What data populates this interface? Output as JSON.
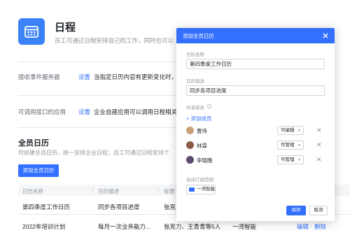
{
  "app": {
    "title": "日程",
    "description": "员工可通过日程安排自己的工作，同时也可以"
  },
  "settings": [
    {
      "label": "接收事件服务器",
      "link": "设置",
      "desc": "当指定日历内容有更新变化时，"
    },
    {
      "label": "可调用接口的应用",
      "link": "设置",
      "desc": "企业自建应用可以调用日程相关"
    }
  ],
  "section": {
    "title": "全员日历",
    "description": "可创建全员日历，统一安排企业日程；员工可通过日程安排个",
    "add_button": "添加全员日历"
  },
  "table": {
    "headers": [
      "日历名称",
      "日历描述",
      "管理"
    ],
    "rows": [
      {
        "name": "第四季度工作日历",
        "desc": "同步各项目进度",
        "managers": "张克",
        "sync": "",
        "ops": []
      },
      {
        "name": "2022年培训计划",
        "desc": "每月一次业务能力...",
        "managers": "张克力、王青青等5人",
        "sync": "一湾智能",
        "ops": [
          "编辑",
          "删除"
        ]
      }
    ]
  },
  "modal": {
    "title": "添加全员日历",
    "name_label": "日历名称",
    "name_value": "第四季度工作日历",
    "desc_label": "日历描述",
    "desc_value": "同步各项目进度",
    "members_label": "共享成员",
    "add_member": "添加成员",
    "members": [
      {
        "name": "曹伟",
        "permission": "可编辑"
      },
      {
        "name": "林霖",
        "permission": "可管理"
      },
      {
        "name": "李晓晚",
        "permission": "可管理"
      }
    ],
    "sync_label": "自动订阅范围",
    "sync_value": "一湾智能",
    "save": "保存",
    "cancel": "取消"
  },
  "colors": {
    "primary": "#3370ff",
    "app_icon": "#3b82f6"
  }
}
